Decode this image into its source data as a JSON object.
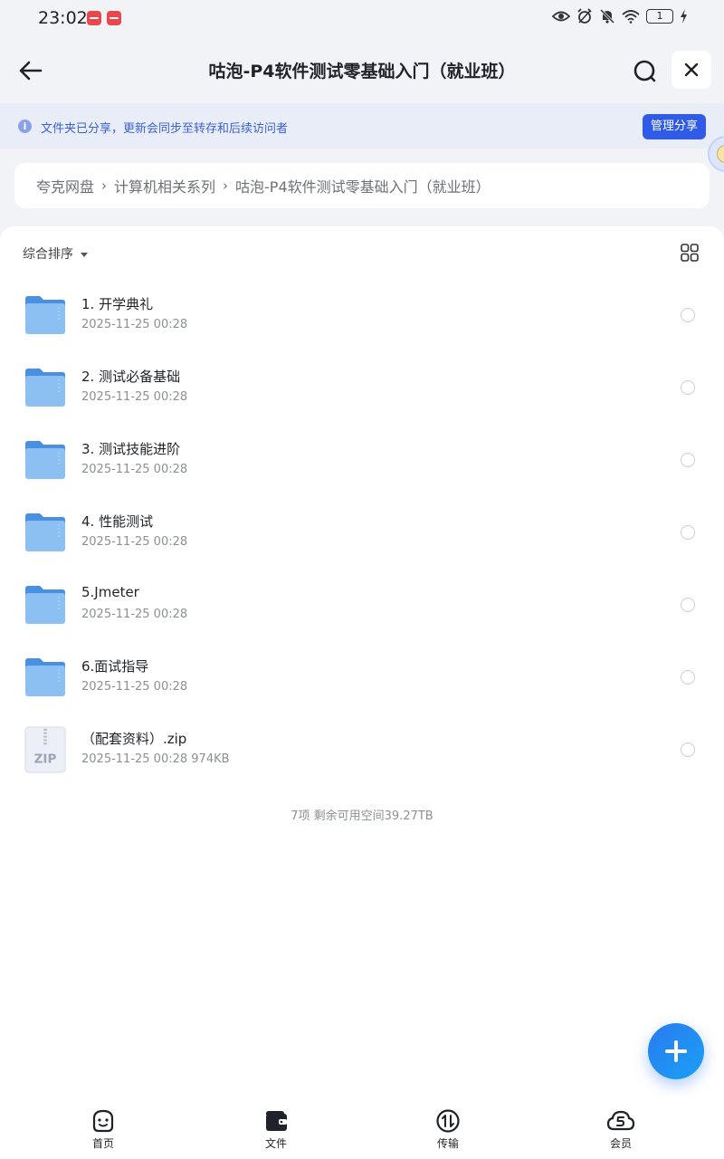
{
  "status_bar": {
    "time": "23:02",
    "battery_level": "1",
    "icons": [
      "eye-icon",
      "alarm-icon",
      "mute-icon",
      "wifi-icon",
      "battery-icon",
      "charging-icon"
    ]
  },
  "header": {
    "title": "咕泡-P4软件测试零基础入门（就业班）",
    "back_icon": "arrow-left-icon",
    "search_icon": "search-icon",
    "close_icon": "close-icon"
  },
  "share_banner": {
    "message": "文件夹已分享，更新会同步至转存和后续访问者",
    "button_label": "管理分享",
    "accent_color": "#2f5be6"
  },
  "breadcrumb": {
    "items": [
      "夸克网盘",
      "计算机相关系列",
      "咕泡-P4软件测试零基础入门（就业班）"
    ],
    "separator": "›"
  },
  "toolbar": {
    "sort_label": "综合排序"
  },
  "files": [
    {
      "name": "1. 开学典礼",
      "meta": "2025-11-25 00:28",
      "type": "folder"
    },
    {
      "name": "2. 测试必备基础",
      "meta": "2025-11-25 00:28",
      "type": "folder"
    },
    {
      "name": "3. 测试技能进阶",
      "meta": "2025-11-25 00:28",
      "type": "folder"
    },
    {
      "name": "4. 性能测试",
      "meta": "2025-11-25 00:28",
      "type": "folder"
    },
    {
      "name": "5.Jmeter",
      "meta": "2025-11-25 00:28",
      "type": "folder"
    },
    {
      "name": "6.面试指导",
      "meta": "2025-11-25 00:28",
      "type": "folder"
    },
    {
      "name": "（配套资料）.zip",
      "meta": "2025-11-25 00:28  974KB",
      "type": "zip",
      "badge": "ZIP"
    }
  ],
  "summary": "7项 剩余可用空间39.27TB",
  "bottom_nav": [
    {
      "label": "首页",
      "icon": "home-face-icon"
    },
    {
      "label": "文件",
      "icon": "folder-wallet-icon"
    },
    {
      "label": "传输",
      "icon": "transfer-icon"
    },
    {
      "label": "会员",
      "icon": "member-cloud-icon"
    }
  ]
}
